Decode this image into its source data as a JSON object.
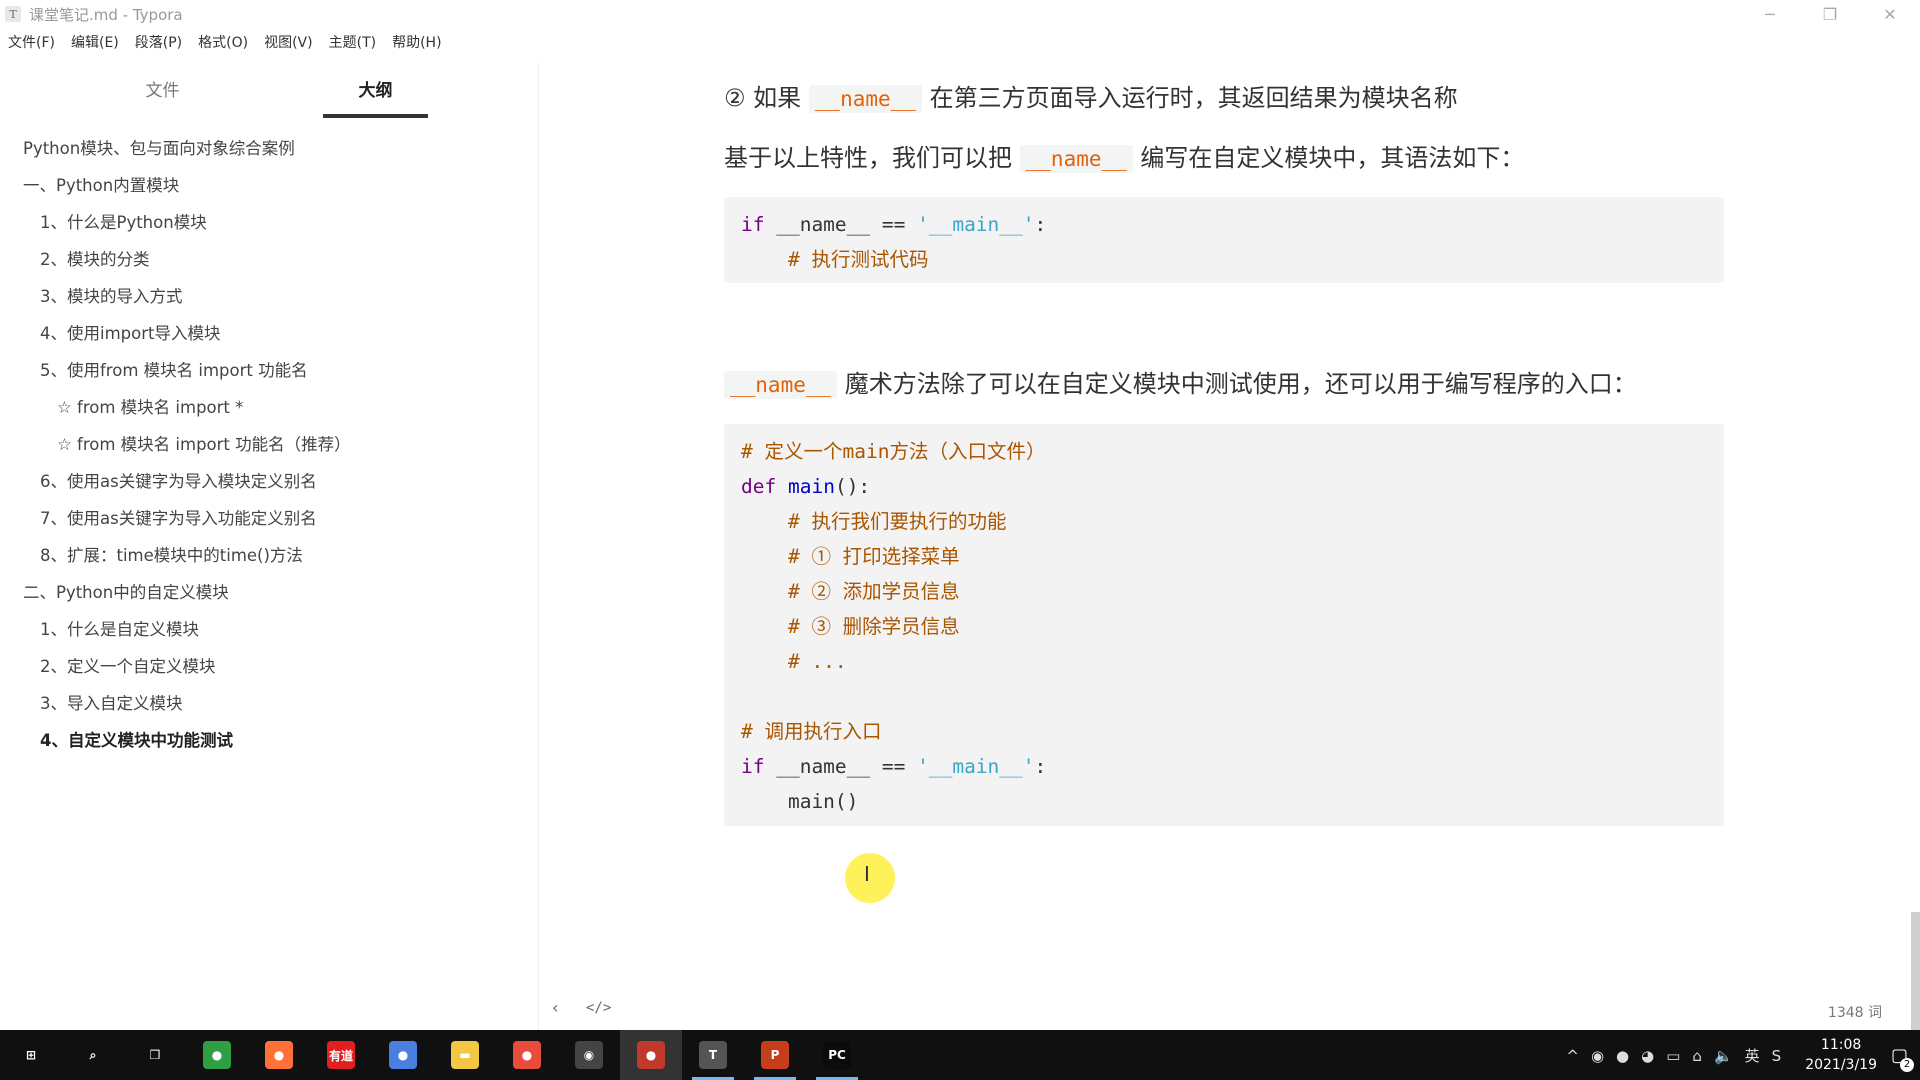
{
  "window": {
    "title": "课堂笔记.md - Typora",
    "app_icon_letter": "T",
    "controls": {
      "minimize": "─",
      "maximize": "❐",
      "close": "✕"
    }
  },
  "menu": [
    "文件(F)",
    "编辑(E)",
    "段落(P)",
    "格式(O)",
    "视图(V)",
    "主题(T)",
    "帮助(H)"
  ],
  "sidebar": {
    "tabs": {
      "file": "文件",
      "outline": "大纲"
    },
    "outline": [
      {
        "label": "Python模块、包与面向对象综合案例",
        "level": 1
      },
      {
        "label": "一、Python内置模块",
        "level": 1
      },
      {
        "label": "1、什么是Python模块",
        "level": 2
      },
      {
        "label": "2、模块的分类",
        "level": 2
      },
      {
        "label": "3、模块的导入方式",
        "level": 2
      },
      {
        "label": "4、使用import导入模块",
        "level": 2
      },
      {
        "label": "5、使用from 模块名 import 功能名",
        "level": 2
      },
      {
        "label": "☆ from 模块名 import *",
        "level": 3
      },
      {
        "label": "☆ from 模块名 import 功能名（推荐）",
        "level": 3
      },
      {
        "label": "6、使用as关键字为导入模块定义别名",
        "level": 2
      },
      {
        "label": "7、使用as关键字为导入功能定义别名",
        "level": 2
      },
      {
        "label": "8、扩展：time模块中的time()方法",
        "level": 2
      },
      {
        "label": "二、Python中的自定义模块",
        "level": 1
      },
      {
        "label": "1、什么是自定义模块",
        "level": 2
      },
      {
        "label": "2、定义一个自定义模块",
        "level": 2
      },
      {
        "label": "3、导入自定义模块",
        "level": 2
      },
      {
        "label": "4、自定义模块中功能测试",
        "level": 2,
        "active": true
      }
    ]
  },
  "content": {
    "p1": {
      "prefix": "② 如果 ",
      "code": "__name__",
      "suffix": " 在第三方页面导入运行时，其返回结果为模块名称"
    },
    "p2": {
      "prefix": "基于以上特性，我们可以把 ",
      "code": "__name__",
      "suffix": " 编写在自定义模块中，其语法如下："
    },
    "code1": [
      [
        {
          "t": "if",
          "c": "kw"
        },
        {
          "t": " __name__ == ",
          "c": ""
        },
        {
          "t": "'__main__'",
          "c": "str"
        },
        {
          "t": ":",
          "c": ""
        }
      ],
      [
        {
          "t": "    # 执行测试代码",
          "c": "cm"
        }
      ]
    ],
    "p3": {
      "code": "__name__",
      "suffix": " 魔术方法除了可以在自定义模块中测试使用，还可以用于编写程序的入口："
    },
    "code2": [
      [
        {
          "t": "# 定义一个main方法（入口文件）",
          "c": "cm"
        }
      ],
      [
        {
          "t": "def",
          "c": "kw"
        },
        {
          "t": " ",
          "c": ""
        },
        {
          "t": "main",
          "c": "fn"
        },
        {
          "t": "():",
          "c": ""
        }
      ],
      [
        {
          "t": "    # 执行我们要执行的功能",
          "c": "cm"
        }
      ],
      [
        {
          "t": "    # ① 打印选择菜单",
          "c": "cm"
        }
      ],
      [
        {
          "t": "    # ② 添加学员信息",
          "c": "cm"
        }
      ],
      [
        {
          "t": "    # ③ 删除学员信息",
          "c": "cm"
        }
      ],
      [
        {
          "t": "    # ...",
          "c": "cm"
        }
      ],
      [
        {
          "t": "",
          "c": ""
        }
      ],
      [
        {
          "t": "# 调用执行入口",
          "c": "cm"
        }
      ],
      [
        {
          "t": "if",
          "c": "kw"
        },
        {
          "t": " __name__ == ",
          "c": ""
        },
        {
          "t": "'__main__'",
          "c": "str"
        },
        {
          "t": ":",
          "c": ""
        }
      ],
      [
        {
          "t": "    main()",
          "c": ""
        }
      ]
    ]
  },
  "statusbar": {
    "back": "‹",
    "source": "</>",
    "word_count": "1348 词"
  },
  "cursor": "I",
  "taskbar": {
    "apps": [
      {
        "name": "start",
        "glyph": "⊞",
        "color": "#101010"
      },
      {
        "name": "search",
        "glyph": "⌕",
        "color": "#101010"
      },
      {
        "name": "task-view",
        "glyph": "❒",
        "color": "#101010"
      },
      {
        "name": "chrome",
        "glyph": "●",
        "color": "#2f9e44"
      },
      {
        "name": "firefox",
        "glyph": "●",
        "color": "#ff7139"
      },
      {
        "name": "youdao",
        "glyph": "有道",
        "color": "#e02020"
      },
      {
        "name": "chromium",
        "glyph": "●",
        "color": "#4a7fe0"
      },
      {
        "name": "file-explorer",
        "glyph": "▬",
        "color": "#f2c744"
      },
      {
        "name": "screen-recorder",
        "glyph": "●",
        "color": "#e84c3d"
      },
      {
        "name": "app-circle",
        "glyph": "◉",
        "color": "#444"
      },
      {
        "name": "recorder",
        "glyph": "●",
        "color": "#c0392b",
        "active": true
      },
      {
        "name": "typora",
        "glyph": "T",
        "color": "#555",
        "running": true
      },
      {
        "name": "powerpoint",
        "glyph": "P",
        "color": "#c43e1c",
        "running": true
      },
      {
        "name": "pycharm",
        "glyph": "PC",
        "color": "#0b0b0b",
        "running": true
      }
    ],
    "tray": [
      "^",
      "◉",
      "●",
      "◕",
      "▭",
      "⌂",
      "🔈",
      "英",
      "S"
    ],
    "clock": {
      "time": "11:08",
      "date": "2021/3/19"
    },
    "notifications": {
      "glyph": "▢",
      "count": "2"
    }
  }
}
